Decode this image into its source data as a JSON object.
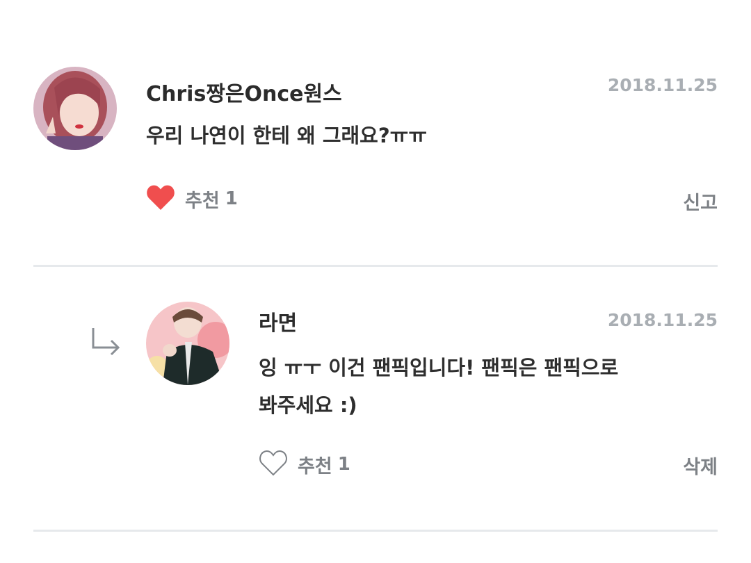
{
  "comments": [
    {
      "author": "Chris짱은Once원스",
      "date": "2018.11.25",
      "text": "우리 나연이 한테 왜 그래요?ㅠㅠ",
      "like_label": "추천",
      "like_count": "1",
      "like_icon": "heart-filled-icon",
      "action_label": "신고",
      "colors": {
        "heart": "#f04e4e"
      }
    },
    {
      "author": "라면",
      "date": "2018.11.25",
      "text": "잉 ㅠㅜ 이건 팬픽입니다! 팬픽은 팬픽으로\n봐주세요 :)",
      "like_label": "추천",
      "like_count": "1",
      "like_icon": "heart-outline-icon",
      "action_label": "삭제",
      "reply_icon": "reply-arrow-icon"
    }
  ]
}
